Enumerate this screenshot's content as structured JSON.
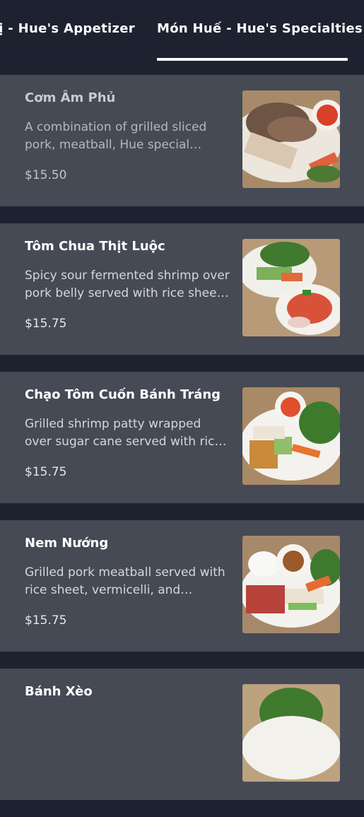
{
  "tabs": [
    {
      "label": "Vị - Hue's Appetizer",
      "active": false
    },
    {
      "label": "Món Huế - Hue's Specialties",
      "active": true
    }
  ],
  "items": [
    {
      "name": "Cơm Âm Phủ",
      "description": "A combination of grilled sliced pork, meatball, Hue special sausage, shredded egg and vegetables",
      "price": "$15.50",
      "image_icon": "com-am-phu-photo"
    },
    {
      "name": "Tôm Chua Thịt Luộc",
      "description": "Spicy sour fermented shrimp over pork belly served with rice sheet and vegetables",
      "price": "$15.75",
      "image_icon": "tom-chua-photo"
    },
    {
      "name": "Chạo Tôm Cuốn Bánh Tráng",
      "description": "Grilled shrimp patty wrapped over sugar cane served with rice sheet and vegetables",
      "price": "$15.75",
      "image_icon": "chao-tom-photo"
    },
    {
      "name": "Nem Nướng",
      "description": "Grilled pork meatball served with rice sheet, vermicelli, and vegetables",
      "price": "$15.75",
      "image_icon": "nem-nuong-photo"
    },
    {
      "name": "Bánh Xèo",
      "description": "",
      "price": "",
      "image_icon": "banh-xeo-photo"
    }
  ]
}
